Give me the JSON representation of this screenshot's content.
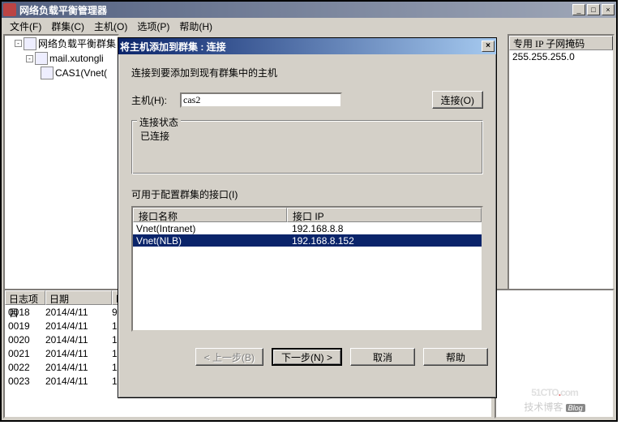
{
  "window": {
    "title": "网络负载平衡管理器",
    "min": "_",
    "max": "□",
    "close": "×"
  },
  "menubar": {
    "file": "文件(F)",
    "cluster": "群集(C)",
    "host": "主机(O)",
    "options": "选项(P)",
    "help": "帮助(H)"
  },
  "tree": {
    "root": "网络负载平衡群集",
    "cluster": "mail.xutongli",
    "host": "CAS1(Vnet("
  },
  "right": {
    "header": "专用 IP 子网掩码",
    "value": "255.255.255.0"
  },
  "log": {
    "col1": "日志项目",
    "col2": "日期",
    "col3": "时",
    "rows": [
      {
        "id": "0018",
        "date": "2014/4/11",
        "t": "9"
      },
      {
        "id": "0019",
        "date": "2014/4/11",
        "t": "1"
      },
      {
        "id": "0020",
        "date": "2014/4/11",
        "t": "1"
      },
      {
        "id": "0021",
        "date": "2014/4/11",
        "t": "1"
      },
      {
        "id": "0022",
        "date": "2014/4/11",
        "t": "1"
      },
      {
        "id": "0023",
        "date": "2014/4/11",
        "t": "1"
      }
    ]
  },
  "watermark": {
    "brand": "51CTO",
    "dot": ".",
    "ext": "com",
    "sub": "技术博客",
    "blog": "Blog"
  },
  "dialog": {
    "title": "将主机添加到群集 :  连接",
    "close": "×",
    "instr": "连接到要添加到现有群集中的主机",
    "host_label": "主机(H):",
    "host_value": "cas2",
    "connect_btn": "连接(O)",
    "status_legend": "连接状态",
    "status_text": "已连接",
    "iface_label": "可用于配置群集的接口(I)",
    "iface_header_name": "接口名称",
    "iface_header_ip": "接口 IP",
    "ifaces": [
      {
        "name": "Vnet(Intranet)",
        "ip": "192.168.8.8",
        "sel": false
      },
      {
        "name": "Vnet(NLB)",
        "ip": "192.168.8.152",
        "sel": true
      }
    ],
    "btn_back": "< 上一步(B)",
    "btn_next": "下一步(N) >",
    "btn_cancel": "取消",
    "btn_help": "帮助"
  }
}
